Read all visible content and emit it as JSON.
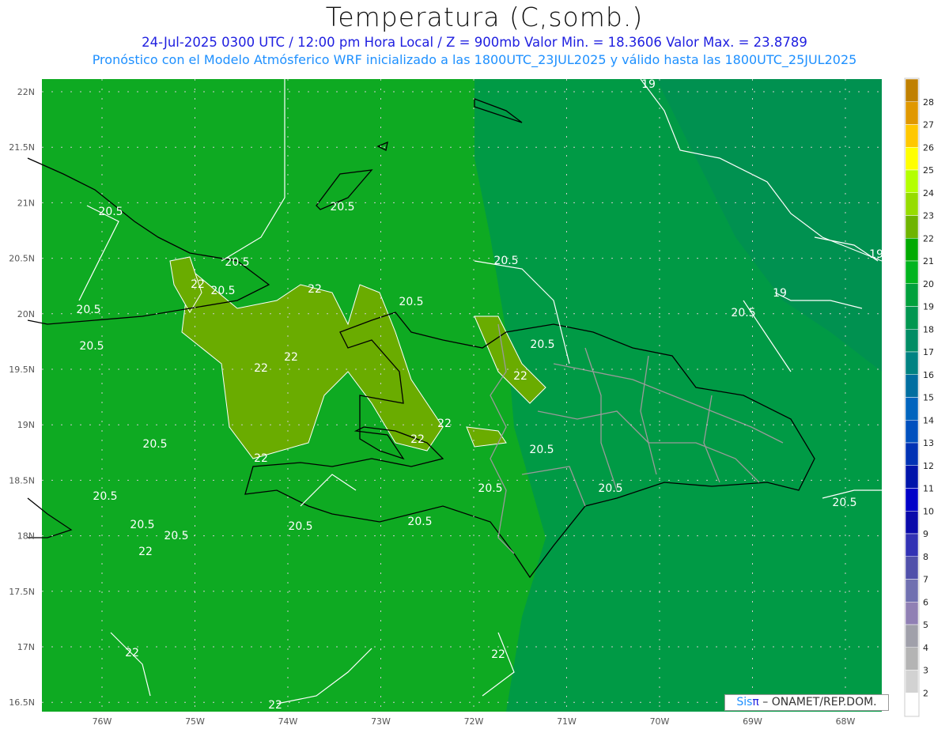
{
  "title": "Temperatura (C,somb.)",
  "subtitle1": "24-Jul-2025  0300 UTC / 12:00 pm Hora Local / Z = 900mb   Valor Min. = 18.3606  Valor Max. = 23.8789",
  "subtitle2": "Pronóstico con el Modelo Atmósferico WRF inicializado a las 1800UTC_23JUL2025 y válido hasta las  1800UTC_25JUL2025",
  "lat_labels": [
    "22N",
    "21.5N",
    "21N",
    "20.5N",
    "20N",
    "19.5N",
    "19N",
    "18.5N",
    "18N",
    "17.5N",
    "17N",
    "16.5N"
  ],
  "lon_labels": [
    "76W",
    "75W",
    "74W",
    "73W",
    "72W",
    "71W",
    "70W",
    "69W",
    "68W"
  ],
  "contour_labels": [
    "19",
    "19",
    "19",
    "20.5",
    "20.5",
    "20.5",
    "20.5",
    "20.5",
    "20.5",
    "20.5",
    "20.5",
    "20.5",
    "20.5",
    "20.5",
    "20.5",
    "20.5",
    "20.5",
    "20.5",
    "20.5",
    "20.5",
    "20.5",
    "20.5",
    "20.5",
    "22",
    "22",
    "22",
    "22",
    "22",
    "22",
    "22"
  ],
  "colorbar": {
    "labels": [
      "28",
      "27",
      "26",
      "25",
      "24",
      "23",
      "22",
      "21",
      "20",
      "19",
      "18",
      "17",
      "16",
      "15",
      "14",
      "13",
      "12",
      "11",
      "10",
      "9",
      "8",
      "7",
      "6",
      "5",
      "4",
      "3",
      "2"
    ],
    "colors": [
      "#c08000",
      "#e09800",
      "#ffc800",
      "#ffff00",
      "#b4ff00",
      "#96dc00",
      "#6eb400",
      "#00aa00",
      "#00b41e",
      "#00a03c",
      "#009650",
      "#008c64",
      "#008282",
      "#006ea0",
      "#0064be",
      "#0050be",
      "#0032b4",
      "#0014aa",
      "#0000c8",
      "#0a0aaa",
      "#3232b4",
      "#5050aa",
      "#7070b0",
      "#9080b4",
      "#a0a0aa",
      "#b4b4b4",
      "#d2d2d2",
      "#ffffff"
    ]
  },
  "credit": {
    "sis": "Sis",
    "pi": "π",
    "rest": " – ONAMET/REP.DOM."
  }
}
